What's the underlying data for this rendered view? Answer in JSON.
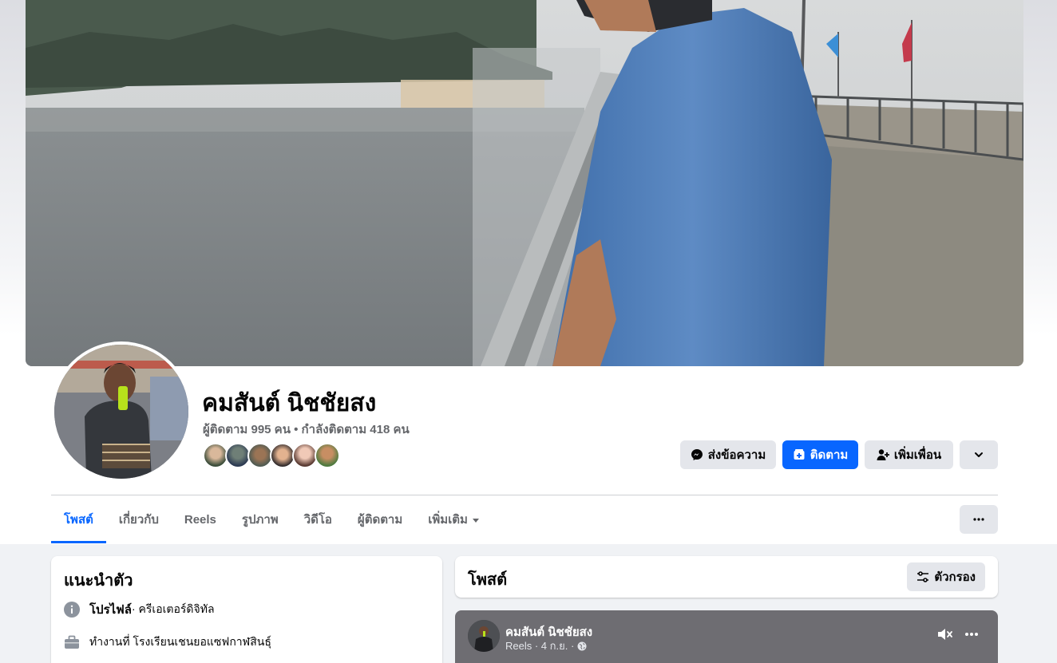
{
  "profile": {
    "name": "คมสันต์ นิชชัยสง",
    "follow_stats": "ผู้ติดตาม 995 คน • กำลังติดตาม 418 คน"
  },
  "actions": {
    "message_label": "ส่งข้อความ",
    "follow_label": "ติดตาม",
    "add_friend_label": "เพิ่มเพื่อน"
  },
  "tabs": [
    {
      "label": "โพสต์"
    },
    {
      "label": "เกี่ยวกับ"
    },
    {
      "label": "Reels"
    },
    {
      "label": "รูปภาพ"
    },
    {
      "label": "วิดีโอ"
    },
    {
      "label": "ผู้ติดตาม"
    },
    {
      "label": "เพิ่มเติม"
    }
  ],
  "intro": {
    "title": "แนะนำตัว",
    "profile_label": "โปรไฟล์",
    "profile_detail": " · ครีเอเตอร์ดิจิทัล",
    "work": "ทำงานที่ โรงเรียนเชนยอแซฟกาฬสินธุ์"
  },
  "posts": {
    "title": "โพสต์",
    "filter_label": "ตัวกรอง"
  },
  "reel_post": {
    "author": "คมสันต์ นิชชัยสง",
    "meta": "Reels · 4 ก.ย. ·"
  },
  "colors": {
    "accent": "#0866ff",
    "button_grey": "#e4e6eb",
    "text_secondary": "#65676b"
  }
}
